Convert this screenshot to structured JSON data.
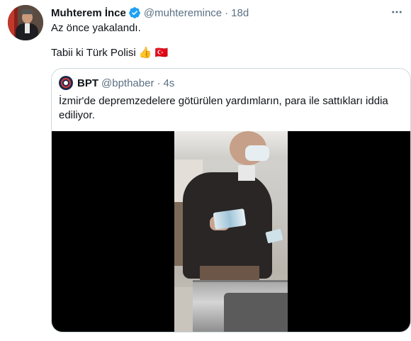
{
  "tweet": {
    "display_name": "Muhterem İnce",
    "handle": "@muhteremince",
    "separator": "·",
    "time": "18d",
    "line1": "Az önce yakalandı.",
    "line2": "Tabii ki Türk Polisi",
    "emoji_thumbs": "👍",
    "emoji_flag": "🇹🇷",
    "colors": {
      "verified": "#1da1f2",
      "secondary_text": "#5b7083",
      "border": "#cfd9de"
    }
  },
  "quote": {
    "display_name": "BPT",
    "handle": "@bpthaber",
    "separator": "·",
    "time": "4s",
    "text": "İzmir'de depremzedelere götürülen yardımların, para ile sattıkları iddia ediliyor."
  },
  "icons": {
    "verified": "verified-badge-icon",
    "more": "more-options-icon"
  }
}
